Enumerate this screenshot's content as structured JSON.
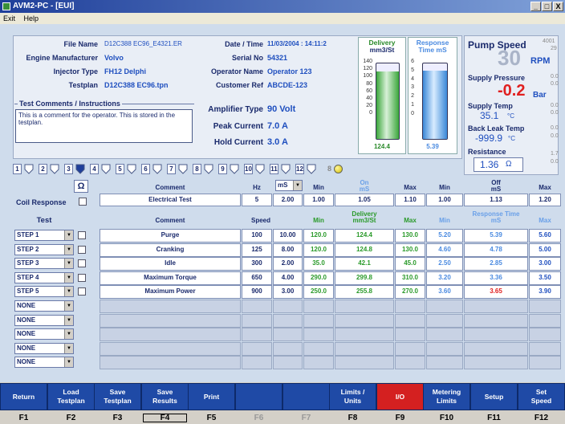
{
  "window": {
    "title": "AVM2-PC - [EUI]",
    "min": "_",
    "max": "□",
    "close": "X"
  },
  "menu": {
    "exit": "Exit",
    "help": "Help"
  },
  "info": {
    "file_name_label": "File Name",
    "file_name": "D12C388 EC96_E4321.ER",
    "engine_mfr_label": "Engine Manufacturer",
    "engine_mfr": "Volvo",
    "injector_type_label": "Injector Type",
    "injector_type": "FH12 Delphi",
    "testplan_label": "Testplan",
    "testplan": "D12C388 EC96.tpn",
    "date_time_label": "Date / Time",
    "date_time": "11/03/2004 : 14:11:2",
    "serial_label": "Serial No",
    "serial": "54321",
    "operator_label": "Operator Name",
    "operator": "Operator 123",
    "customer_label": "Customer Ref",
    "customer": "ABCDE-123",
    "amp_type_label": "Amplifier Type",
    "amp_type": "90 Volt",
    "peak_label": "Peak Current",
    "peak": "7.0 A",
    "hold_label": "Hold Current",
    "hold": "3.0 A",
    "comments_legend": "Test Comments / Instructions",
    "comments": "This is a comment for the operator. This is stored in the testplan."
  },
  "gauges": {
    "delivery": {
      "title": "Delivery",
      "unit": "mm3/St",
      "ticks": [
        "140",
        "120",
        "100",
        "80",
        "60",
        "40",
        "20",
        "0"
      ],
      "value": "124.4",
      "level": 0.89,
      "color": "#3aa63a"
    },
    "response": {
      "title": "Response",
      "unit": "Time mS",
      "ticks": [
        "6",
        "5",
        "4",
        "3",
        "2",
        "1",
        "0"
      ],
      "value": "5.39",
      "level": 0.9,
      "color": "#5aa8e8"
    }
  },
  "pump": {
    "title": "Pump Speed",
    "speed": "30",
    "speed_unit": "RPM",
    "speed_side_1": "4001",
    "speed_side_2": "29",
    "supply_pressure_label": "Supply Pressure",
    "supply_pressure": "-0.2",
    "supply_pressure_unit": "Bar",
    "sp_side_1": "0.0",
    "sp_side_2": "0.0",
    "supply_temp_label": "Supply Temp",
    "supply_temp": "35.1",
    "supply_temp_unit": "°C",
    "st_side_1": "0.0",
    "st_side_2": "0.0",
    "back_leak_label": "Back Leak Temp",
    "back_leak": "-999.9",
    "back_leak_unit": "°C",
    "bl_side_1": "0.0",
    "bl_side_2": "0.0",
    "resistance_label": "Resistance",
    "resistance": "1.36",
    "resistance_unit": "Ω",
    "r_side_1": "1.7",
    "r_side_2": "0.0"
  },
  "steps": {
    "numbers": [
      "1",
      "2",
      "3",
      "4",
      "5",
      "6",
      "7",
      "8",
      "9",
      "10",
      "11",
      "12"
    ],
    "indicator": "8"
  },
  "elec": {
    "ohm": "Ω",
    "coil_response": "Coil Response",
    "h_comment": "Comment",
    "h_hz": "Hz",
    "ms_select": "mS",
    "h_min": "Min",
    "h_on": "On",
    "h_on_unit": "mS",
    "h_max": "Max",
    "h_min2": "Min",
    "h_off": "Off",
    "h_off_unit": "mS",
    "h_max2": "Max",
    "row": {
      "comment": "Electrical Test",
      "hz": "5",
      "ms": "2.00",
      "min": "1.00",
      "on": "1.05",
      "max": "1.10",
      "min2": "1.00",
      "off": "1.13",
      "max2": "1.20"
    }
  },
  "tests": {
    "h_test": "Test",
    "h_comment": "Comment",
    "h_speed": "Speed",
    "h_min": "Min",
    "h_delivery": "Delivery",
    "h_delivery_unit": "mm3/St",
    "h_max": "Max",
    "h_min2": "Min",
    "h_resp": "Response Time",
    "h_resp_unit": "mS",
    "h_max2": "Max",
    "rows": [
      {
        "step": "STEP 1",
        "comment": "Purge",
        "speed": "100",
        "time": "10.00",
        "min": "120.0",
        "delivery": "124.4",
        "max": "130.0",
        "rmin": "5.20",
        "resp": "5.39",
        "rmax": "5.60"
      },
      {
        "step": "STEP 2",
        "comment": "Cranking",
        "speed": "125",
        "time": "8.00",
        "min": "120.0",
        "delivery": "124.8",
        "max": "130.0",
        "rmin": "4.60",
        "resp": "4.78",
        "rmax": "5.00"
      },
      {
        "step": "STEP 3",
        "comment": "Idle",
        "speed": "300",
        "time": "2.00",
        "min": "35.0",
        "delivery": "42.1",
        "max": "45.0",
        "rmin": "2.50",
        "resp": "2.85",
        "rmax": "3.00"
      },
      {
        "step": "STEP 4",
        "comment": "Maximum Torque",
        "speed": "650",
        "time": "4.00",
        "min": "290.0",
        "delivery": "299.8",
        "max": "310.0",
        "rmin": "3.20",
        "resp": "3.36",
        "rmax": "3.50"
      },
      {
        "step": "STEP 5",
        "comment": "Maximum Power",
        "speed": "900",
        "time": "3.00",
        "min": "250.0",
        "delivery": "255.8",
        "max": "270.0",
        "rmin": "3.60",
        "resp": "3.65",
        "rmax": "3.90"
      }
    ],
    "none_rows": [
      "NONE",
      "NONE",
      "NONE",
      "NONE",
      "NONE"
    ]
  },
  "fkeys": [
    {
      "label": "Return",
      "key": "F1"
    },
    {
      "label": "Load\nTestplan",
      "key": "F2"
    },
    {
      "label": "Save\nTestplan",
      "key": "F3"
    },
    {
      "label": "Save\nResults",
      "key": "F4"
    },
    {
      "label": "Print",
      "key": "F5"
    },
    {
      "label": "",
      "key": "F6"
    },
    {
      "label": "",
      "key": "F7"
    },
    {
      "label": "Limits /\nUnits",
      "key": "F8"
    },
    {
      "label": "I/O",
      "key": "F9"
    },
    {
      "label": "Metering\nLimits",
      "key": "F10"
    },
    {
      "label": "Setup",
      "key": "F11"
    },
    {
      "label": "Set\nSpeed",
      "key": "F12"
    }
  ]
}
